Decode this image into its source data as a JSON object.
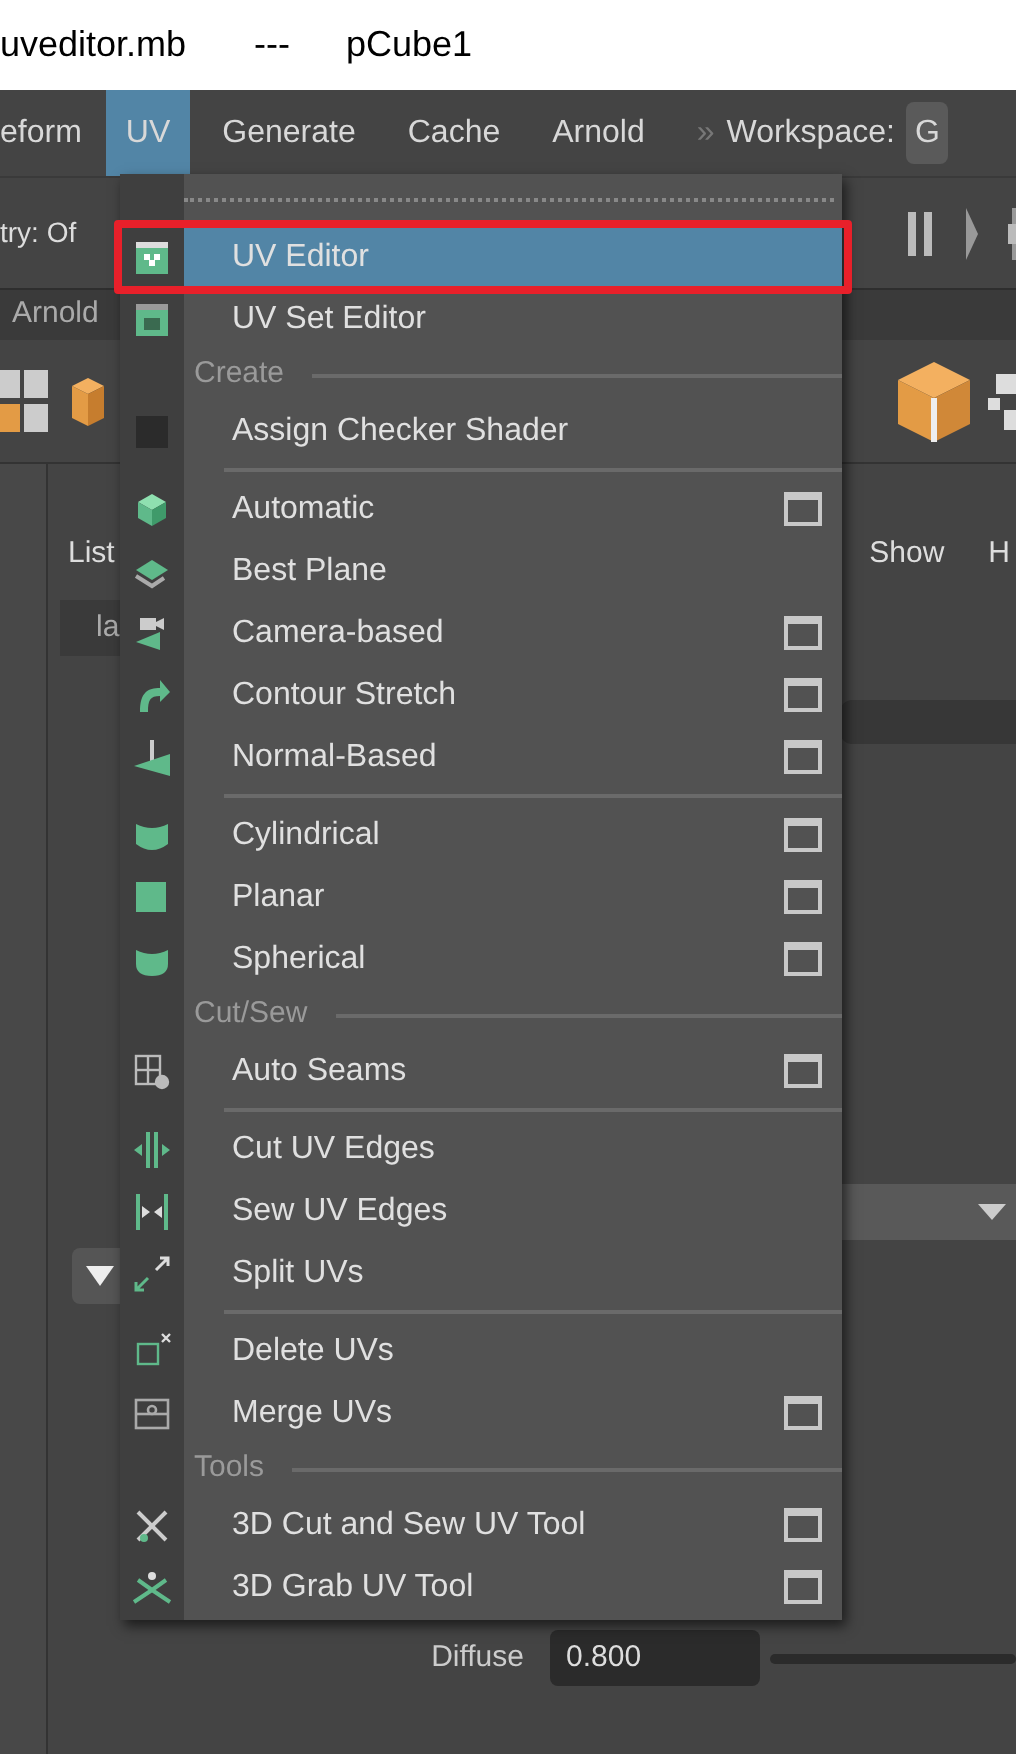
{
  "window": {
    "filename": "uveditor.mb",
    "separator": "---",
    "object": "pCube1"
  },
  "menubar": [
    {
      "label": "eform",
      "selected": false
    },
    {
      "label": "UV",
      "selected": true
    },
    {
      "label": "Generate",
      "selected": false
    },
    {
      "label": "Cache",
      "selected": false
    },
    {
      "label": "Arnold",
      "selected": false
    }
  ],
  "workspace": {
    "chevron": "»",
    "label": "Workspace:",
    "value": "G"
  },
  "toolbar": {
    "symmetry": "try: Of"
  },
  "tabs": [
    {
      "label": "Arnold",
      "selected": false
    }
  ],
  "panel": {
    "list_label": "List",
    "show_label": "Show",
    "help_label": "H",
    "field_value": "la"
  },
  "attributes": [
    {
      "label": "Diffuse",
      "value": "0.800"
    }
  ],
  "menu": {
    "items": [
      {
        "kind": "item",
        "label": "UV Editor",
        "option_box": false,
        "selected": true,
        "outlined": true
      },
      {
        "kind": "item",
        "label": "UV Set Editor",
        "option_box": false,
        "selected": false,
        "outlined": false
      },
      {
        "kind": "header",
        "label": "Create"
      },
      {
        "kind": "item",
        "label": "Assign Checker Shader",
        "option_box": false,
        "selected": false,
        "outlined": false
      },
      {
        "kind": "separator"
      },
      {
        "kind": "item",
        "label": "Automatic",
        "option_box": true,
        "selected": false,
        "outlined": false
      },
      {
        "kind": "item",
        "label": "Best Plane",
        "option_box": false,
        "selected": false,
        "outlined": false
      },
      {
        "kind": "item",
        "label": "Camera-based",
        "option_box": true,
        "selected": false,
        "outlined": false
      },
      {
        "kind": "item",
        "label": "Contour Stretch",
        "option_box": true,
        "selected": false,
        "outlined": false
      },
      {
        "kind": "item",
        "label": "Normal-Based",
        "option_box": true,
        "selected": false,
        "outlined": false
      },
      {
        "kind": "separator"
      },
      {
        "kind": "item",
        "label": "Cylindrical",
        "option_box": true,
        "selected": false,
        "outlined": false
      },
      {
        "kind": "item",
        "label": "Planar",
        "option_box": true,
        "selected": false,
        "outlined": false
      },
      {
        "kind": "item",
        "label": "Spherical",
        "option_box": true,
        "selected": false,
        "outlined": false
      },
      {
        "kind": "header",
        "label": "Cut/Sew"
      },
      {
        "kind": "item",
        "label": "Auto Seams",
        "option_box": true,
        "selected": false,
        "outlined": false
      },
      {
        "kind": "separator"
      },
      {
        "kind": "item",
        "label": "Cut UV Edges",
        "option_box": false,
        "selected": false,
        "outlined": false
      },
      {
        "kind": "item",
        "label": "Sew UV Edges",
        "option_box": false,
        "selected": false,
        "outlined": false
      },
      {
        "kind": "item",
        "label": "Split UVs",
        "option_box": false,
        "selected": false,
        "outlined": false
      },
      {
        "kind": "separator"
      },
      {
        "kind": "item",
        "label": "Delete UVs",
        "option_box": false,
        "selected": false,
        "outlined": false
      },
      {
        "kind": "item",
        "label": "Merge UVs",
        "option_box": true,
        "selected": false,
        "outlined": false
      },
      {
        "kind": "header",
        "label": "Tools"
      },
      {
        "kind": "item",
        "label": "3D Cut and Sew UV Tool",
        "option_box": true,
        "selected": false,
        "outlined": false
      },
      {
        "kind": "item",
        "label": "3D Grab UV Tool",
        "option_box": true,
        "selected": false,
        "outlined": false
      }
    ]
  }
}
